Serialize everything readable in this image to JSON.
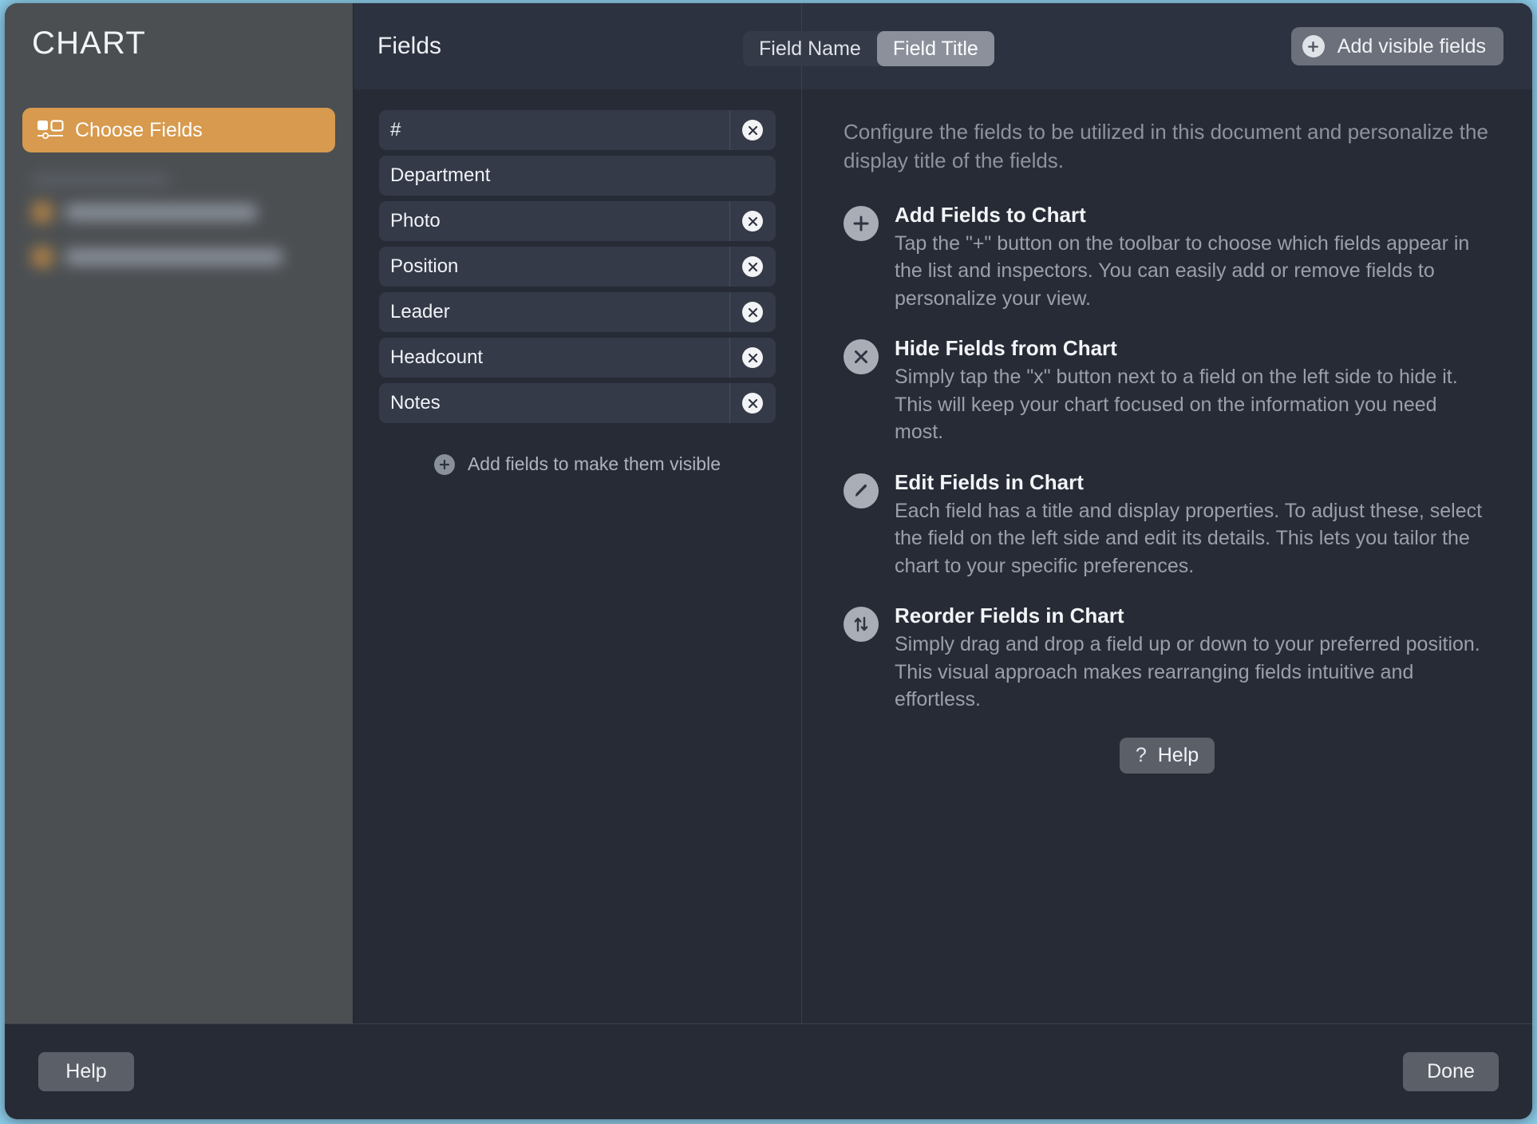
{
  "sidebar": {
    "title": "CHART",
    "active_item": {
      "label": "Choose Fields",
      "icon": "fields-chooser-icon"
    }
  },
  "center": {
    "panel_title": "Fields",
    "fields": [
      {
        "label": "#",
        "removable": true
      },
      {
        "label": "Department",
        "removable": false
      },
      {
        "label": "Photo",
        "removable": true
      },
      {
        "label": "Position",
        "removable": true
      },
      {
        "label": "Leader",
        "removable": true
      },
      {
        "label": "Headcount",
        "removable": true
      },
      {
        "label": "Notes",
        "removable": true
      }
    ],
    "add_hint": "Add fields to make them visible"
  },
  "header": {
    "segmented": {
      "options": [
        "Field Name",
        "Field Title"
      ],
      "selected": "Field Title"
    },
    "add_visible_fields": "Add visible fields"
  },
  "detail": {
    "intro": "Configure the fields to be utilized in this document and personalize the display title of the fields.",
    "tips": [
      {
        "icon": "plus-circle-icon",
        "title": "Add Fields to Chart",
        "text": "Tap the \"+\" button on the toolbar to choose which fields appear in the list and inspectors. You can easily add or remove fields to personalize your view."
      },
      {
        "icon": "x-circle-icon",
        "title": "Hide Fields from Chart",
        "text": "Simply tap the \"x\" button next to a field on the left side to hide it. This will keep your chart focused on the information you need most."
      },
      {
        "icon": "pencil-circle-icon",
        "title": "Edit Fields in Chart",
        "text": "Each field has a title and display properties. To adjust these, select the field on the left side and edit its details. This lets you tailor the chart to your specific preferences."
      },
      {
        "icon": "reorder-arrows-circle-icon",
        "title": "Reorder Fields in Chart",
        "text": "Simply drag and drop a field up or down to your preferred position. This visual approach makes rearranging fields intuitive and effortless."
      }
    ],
    "help_question_mark": "?",
    "help_label": "Help"
  },
  "footer": {
    "help_label": "Help",
    "done_label": "Done"
  },
  "colors": {
    "desktop": "#8ccbe8",
    "sidebar_bg": "#4b4f52",
    "accent_orange": "#d79a4e",
    "panel_bg": "#272b36",
    "header_bg": "#2d3240",
    "row_bg": "#343a48",
    "button_gray": "#5b6068"
  }
}
